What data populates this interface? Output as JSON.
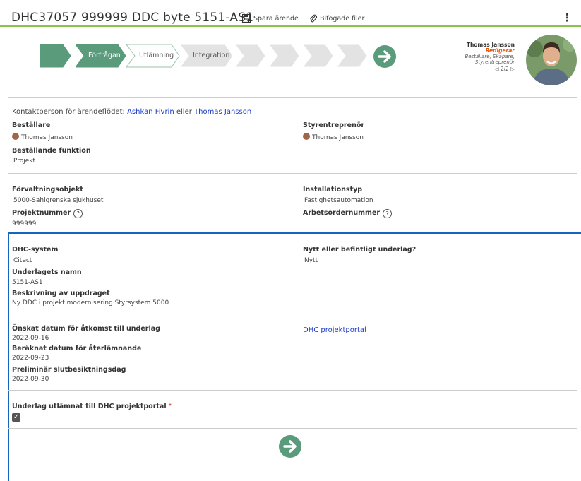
{
  "header": {
    "title": "DHC37057 999999 DDC byte 5151-AS1",
    "save_label": "Spara ärende",
    "attach_label": "Bifogade filer"
  },
  "workflow": {
    "steps": [
      {
        "label": "",
        "state": "done"
      },
      {
        "label": "Förfrågan",
        "state": "done"
      },
      {
        "label": "Utlämning",
        "state": "current"
      },
      {
        "label": "Integration",
        "state": "pending"
      },
      {
        "label": "",
        "state": "pending"
      },
      {
        "label": "",
        "state": "pending"
      },
      {
        "label": "",
        "state": "pending"
      },
      {
        "label": "",
        "state": "pending"
      }
    ],
    "colors": {
      "done": "#5a9b7c",
      "current": "#ffffff",
      "pending": "#e3e3e3",
      "border": "#9ac5a8"
    }
  },
  "user": {
    "name": "Thomas Jansson",
    "role": "Redigerar",
    "roles_line1": "Beställare, Skapare,",
    "roles_line2": "Styrentreprenör",
    "pager": "2/2"
  },
  "contact": {
    "prefix": "Kontaktperson för ärendeflödet:",
    "person1": "Ashkan Fivrin",
    "conj": "eller",
    "person2": "Thomas Jansson"
  },
  "fields": {
    "bestallare_label": "Beställare",
    "bestallare_value": "Thomas Jansson",
    "styrentreprenor_label": "Styrentreprenör",
    "styrentreprenor_value": "Thomas Jansson",
    "bestallande_funktion_label": "Beställande funktion",
    "bestallande_funktion_value": "Projekt",
    "forvaltningsobjekt_label": "Förvaltningsobjekt",
    "forvaltningsobjekt_value": "5000-Sahlgrenska sjukhuset",
    "installationstyp_label": "Installationstyp",
    "installationstyp_value": "Fastighetsautomation",
    "projektnummer_label": "Projektnummer",
    "projektnummer_value": "999999",
    "arbetsordernummer_label": "Arbetsordernummer",
    "help_glyph": "?"
  },
  "panel": {
    "dhc_system_label": "DHC-system",
    "dhc_system_value": "Citect",
    "nytt_label": "Nytt eller befintligt underlag?",
    "nytt_value": "Nytt",
    "underlag_namn_label": "Underlagets namn",
    "underlag_namn_value": "5151-AS1",
    "beskrivning_label": "Beskrivning av uppdraget",
    "beskrivning_value": "Ny DDC i projekt modernisering Styrsystem 5000",
    "onskat_label": "Önskat datum för åtkomst till underlag",
    "onskat_value": "2022-09-16",
    "portal_link": "DHC projektportal",
    "beraknat_label": "Beräknat datum för återlämnande",
    "beraknat_value": "2022-09-23",
    "prelim_label": "Preliminär slutbesiktningsdag",
    "prelim_value": "2022-09-30",
    "underlag_utlamnat_label": "Underlag utlämnat till DHC projektportal",
    "required_mark": "*",
    "checked": true
  },
  "colors": {
    "accent_green": "#8bc34a",
    "link": "#1a3bc8",
    "panel_border": "#1565c0",
    "circle": "#5a9b7c"
  }
}
